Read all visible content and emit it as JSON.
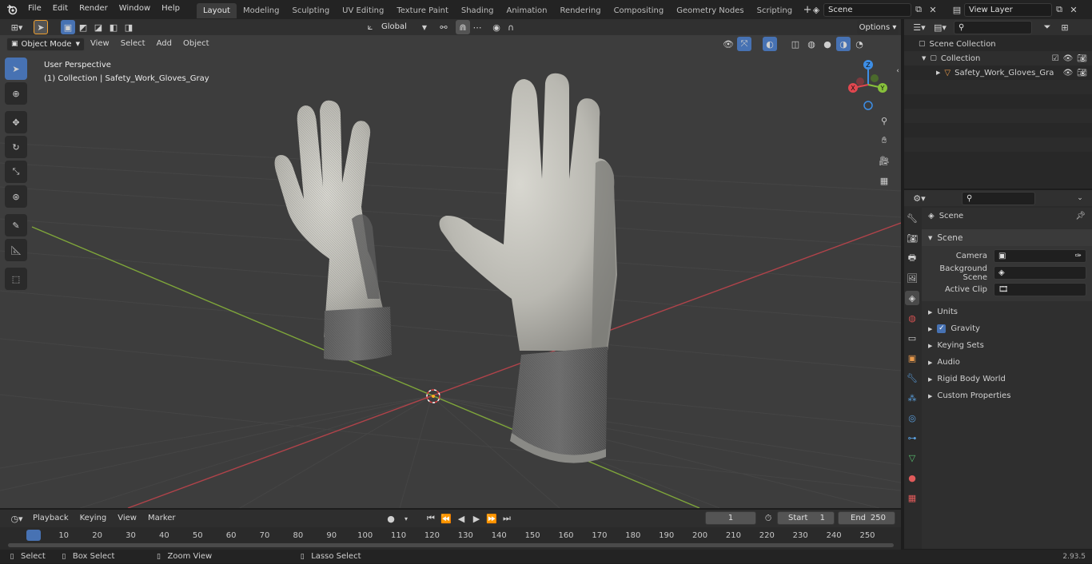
{
  "topbar": {
    "menus": [
      "File",
      "Edit",
      "Render",
      "Window",
      "Help"
    ],
    "workspaces": [
      "Layout",
      "Modeling",
      "Sculpting",
      "UV Editing",
      "Texture Paint",
      "Shading",
      "Animation",
      "Rendering",
      "Compositing",
      "Geometry Nodes",
      "Scripting"
    ],
    "active_workspace": "Layout",
    "scene": "Scene",
    "view_layer": "View Layer"
  },
  "toolheader": {
    "orientation": "Global",
    "options": "Options"
  },
  "viewport_header": {
    "mode": "Object Mode",
    "menus": [
      "View",
      "Select",
      "Add",
      "Object"
    ]
  },
  "overlay": {
    "perspective": "User Perspective",
    "collection": "(1) Collection | Safety_Work_Gloves_Gray"
  },
  "gizmo": {
    "x": "X",
    "y": "Y",
    "z": "Z"
  },
  "outliner": {
    "root": "Scene Collection",
    "collection": "Collection",
    "object": "Safety_Work_Gloves_Gra"
  },
  "properties": {
    "header": "Scene",
    "section": "Scene",
    "camera_label": "Camera",
    "background_label": "Background Scene",
    "clip_label": "Active Clip",
    "panels": [
      "Units",
      "Gravity",
      "Keying Sets",
      "Audio",
      "Rigid Body World",
      "Custom Properties"
    ],
    "gravity_checked": true
  },
  "timeline": {
    "menus": [
      "Playback",
      "Keying",
      "View",
      "Marker"
    ],
    "current_frame": "1",
    "start_label": "Start",
    "start": "1",
    "end_label": "End",
    "end": "250",
    "ticks": [
      "1",
      "10",
      "20",
      "30",
      "40",
      "50",
      "60",
      "70",
      "80",
      "90",
      "100",
      "110",
      "120",
      "130",
      "140",
      "150",
      "160",
      "170",
      "180",
      "190",
      "200",
      "210",
      "220",
      "230",
      "240",
      "250"
    ]
  },
  "statusbar": {
    "select": "Select",
    "box_select": "Box Select",
    "zoom_view": "Zoom View",
    "lasso_select": "Lasso Select",
    "version": "2.93.5"
  },
  "colors": {
    "accent": "#4772b3",
    "viewport_bg": "#3d3d3d",
    "x_axis": "#b0434a",
    "y_axis": "#7fa63a",
    "gizmo_x": "#e2474f",
    "gizmo_y": "#87c13b",
    "gizmo_z": "#3d8ee6"
  }
}
